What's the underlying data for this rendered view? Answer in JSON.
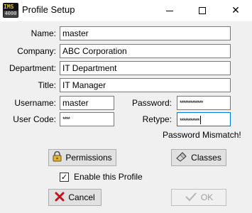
{
  "window": {
    "title": "Profile Setup",
    "icon_top": "IMS",
    "icon_bottom": "4000",
    "close_glyph": "✕"
  },
  "form": {
    "name": {
      "label": "Name:",
      "value": "master"
    },
    "company": {
      "label": "Company:",
      "value": "ABC Corporation"
    },
    "department": {
      "label": "Department:",
      "value": "IT Department"
    },
    "title": {
      "label": "Title:",
      "value": "IT Manager"
    },
    "username": {
      "label": "Username:",
      "value": "master"
    },
    "user_code": {
      "label": "User Code:",
      "value": "****"
    },
    "password": {
      "label": "Password:",
      "value": "*************"
    },
    "retype": {
      "label": "Retype:",
      "value": "***********"
    }
  },
  "status": {
    "mismatch": "Password Mismatch!"
  },
  "buttons": {
    "permissions": {
      "label": "Permissions",
      "icon": "lock-icon"
    },
    "classes": {
      "label": "Classes",
      "icon": "classes-icon"
    },
    "cancel": {
      "label": "Cancel",
      "icon": "x-icon",
      "icon_color": "#c0141e"
    },
    "ok": {
      "label": "OK",
      "icon": "check-icon",
      "enabled": false
    }
  },
  "enable_profile": {
    "label": "Enable this Profile",
    "checked": true
  }
}
